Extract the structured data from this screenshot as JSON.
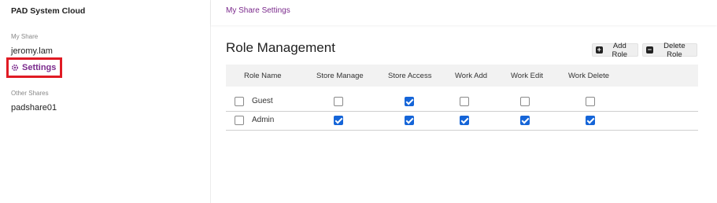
{
  "sidebar": {
    "app_title": "PAD System Cloud",
    "my_share_label": "My Share",
    "user": "jeromy.lam",
    "settings": "Settings",
    "other_shares_label": "Other Shares",
    "other_share": "padshare01"
  },
  "topbar": {
    "title": "My Share Settings"
  },
  "main": {
    "title": "Role Management",
    "add_role": "Add Role",
    "delete_role": "Delete Role",
    "columns": [
      "Role Name",
      "Store Manage",
      "Store Access",
      "Work Add",
      "Work Edit",
      "Work Delete"
    ],
    "rows": [
      {
        "name": "Guest",
        "selected": false,
        "perms": [
          false,
          true,
          false,
          false,
          false
        ]
      },
      {
        "name": "Admin",
        "selected": false,
        "perms": [
          true,
          true,
          true,
          true,
          true
        ]
      }
    ]
  },
  "colors": {
    "accent": "#7b2a8c",
    "checkbox": "#1565d8",
    "highlight": "#e01b24"
  }
}
